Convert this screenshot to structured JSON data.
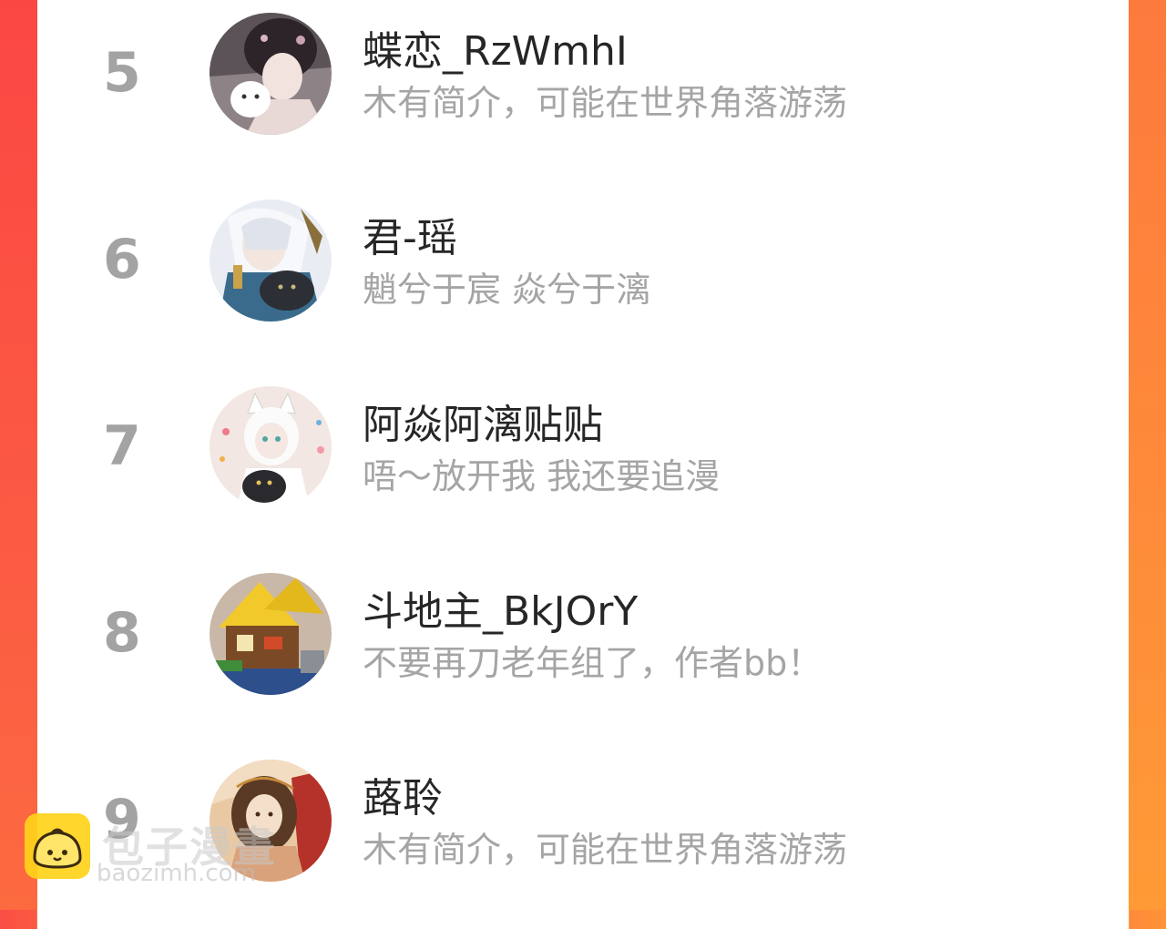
{
  "ranking": [
    {
      "rank": "5",
      "name": "蝶恋_RzWmhI",
      "bio": "木有简介，可能在世界角落游荡",
      "avatar_icon": "girl-with-white-cat-avatar"
    },
    {
      "rank": "6",
      "name": "君-瑶",
      "bio": "魈兮于宸 焱兮于漓",
      "avatar_icon": "white-haired-man-with-black-cat-avatar"
    },
    {
      "rank": "7",
      "name": "阿焱阿漓贴贴",
      "bio": "唔～放开我 我还要追漫",
      "avatar_icon": "white-fox-girl-with-black-cat-avatar"
    },
    {
      "rank": "8",
      "name": "斗地主_BkJOrY",
      "bio": "不要再刀老年组了，作者bb！",
      "avatar_icon": "lego-house-avatar"
    },
    {
      "rank": "9",
      "name": "蕗聆",
      "bio": "木有简介，可能在世界角落游荡",
      "avatar_icon": "long-haired-figure-avatar"
    }
  ],
  "watermark": {
    "title": "包子漫畫",
    "url": "baozimh.com",
    "icon": "bun-mascot-icon"
  },
  "colors": {
    "left_border": "#fb4d45",
    "right_border": "#fe8a3a",
    "rank_gray": "#a3a3a3",
    "name_text": "#262626",
    "bio_text": "#a5a5a5",
    "logo_yellow": "#ffd21a"
  }
}
